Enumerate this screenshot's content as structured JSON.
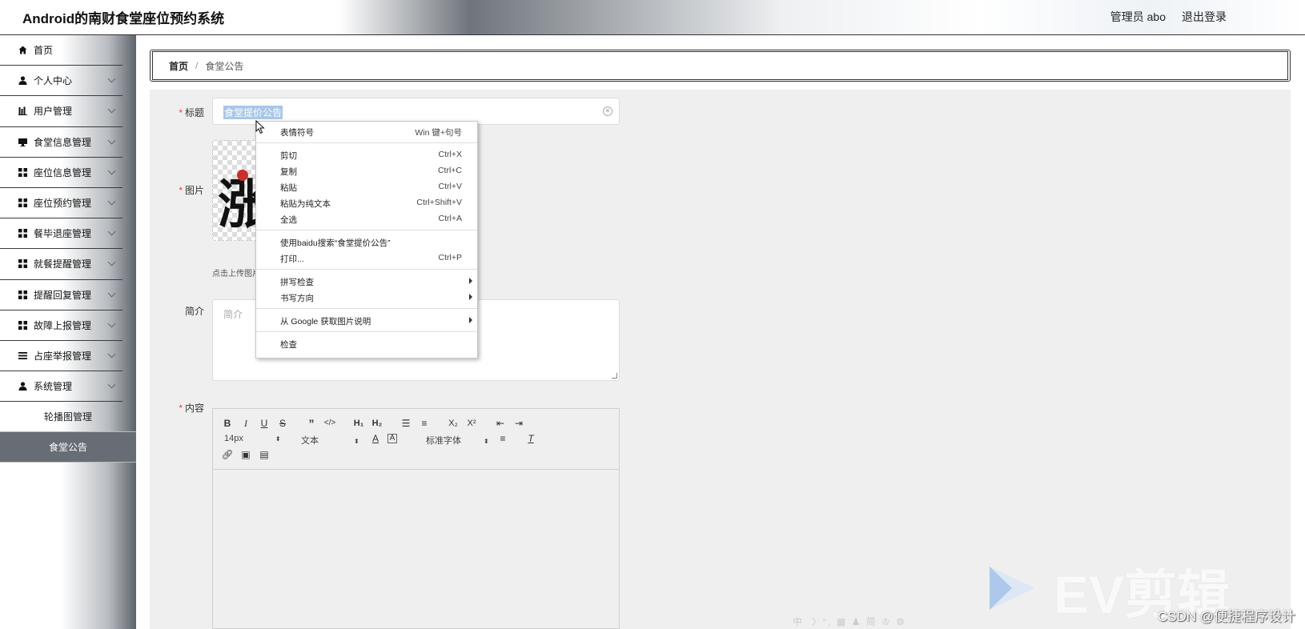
{
  "app": {
    "title": "Android的南财食堂座位预约系统",
    "user": "管理员 abo",
    "logout": "退出登录"
  },
  "sidebar": {
    "items": [
      {
        "label": "首页",
        "icon": "home-icon"
      },
      {
        "label": "个人中心",
        "icon": "user-icon"
      },
      {
        "label": "用户管理",
        "icon": "chart-icon"
      },
      {
        "label": "食堂信息管理",
        "icon": "monitor-icon"
      },
      {
        "label": "座位信息管理",
        "icon": "grid-icon"
      },
      {
        "label": "座位预约管理",
        "icon": "grid-icon"
      },
      {
        "label": "餐毕退座管理",
        "icon": "grid-icon"
      },
      {
        "label": "就餐提醒管理",
        "icon": "grid-icon"
      },
      {
        "label": "提醒回复管理",
        "icon": "grid-icon"
      },
      {
        "label": "故障上报管理",
        "icon": "grid-icon"
      },
      {
        "label": "占座举报管理",
        "icon": "list-icon"
      },
      {
        "label": "系统管理",
        "icon": "user-icon"
      }
    ],
    "sub_items": [
      {
        "label": "轮播图管理"
      },
      {
        "label": "食堂公告"
      }
    ]
  },
  "breadcrumb": {
    "home": "首页",
    "separator": "/",
    "current": "食堂公告"
  },
  "form": {
    "title_label": "标题",
    "title_value": "食堂提价公告",
    "image_label": "图片",
    "upload_hint": "点击上传图片",
    "intro_label": "简介",
    "intro_placeholder": "简介",
    "content_label": "内容"
  },
  "editor": {
    "font_size": "14px",
    "header_select": "文本",
    "font_family": "标准字体"
  },
  "context_menu": {
    "emoji": {
      "label": "表情符号",
      "shortcut": "Win 键+句号"
    },
    "cut": {
      "label": "剪切",
      "shortcut": "Ctrl+X"
    },
    "copy": {
      "label": "复制",
      "shortcut": "Ctrl+C"
    },
    "paste": {
      "label": "粘贴",
      "shortcut": "Ctrl+V"
    },
    "paste_plain": {
      "label": "粘贴为纯文本",
      "shortcut": "Ctrl+Shift+V"
    },
    "select_all": {
      "label": "全选",
      "shortcut": "Ctrl+A"
    },
    "search": {
      "label": "使用baidu搜索“食堂提价公告”"
    },
    "print": {
      "label": "打印...",
      "shortcut": "Ctrl+P"
    },
    "spellcheck": {
      "label": "拼写检查"
    },
    "writing_direction": {
      "label": "书写方向"
    },
    "google_image": {
      "label": "从 Google 获取图片说明"
    },
    "inspect": {
      "label": "检查"
    }
  },
  "watermarks": {
    "ev": "EV剪辑",
    "csdn": "CSDN @便捷程序设计",
    "ime": "中 ☽ °, ▦ ♟ 简 ♔ ⚙"
  },
  "colors": {
    "active_menu": "#676d74",
    "required": "#e64340",
    "selection": "#a9c6e8"
  }
}
